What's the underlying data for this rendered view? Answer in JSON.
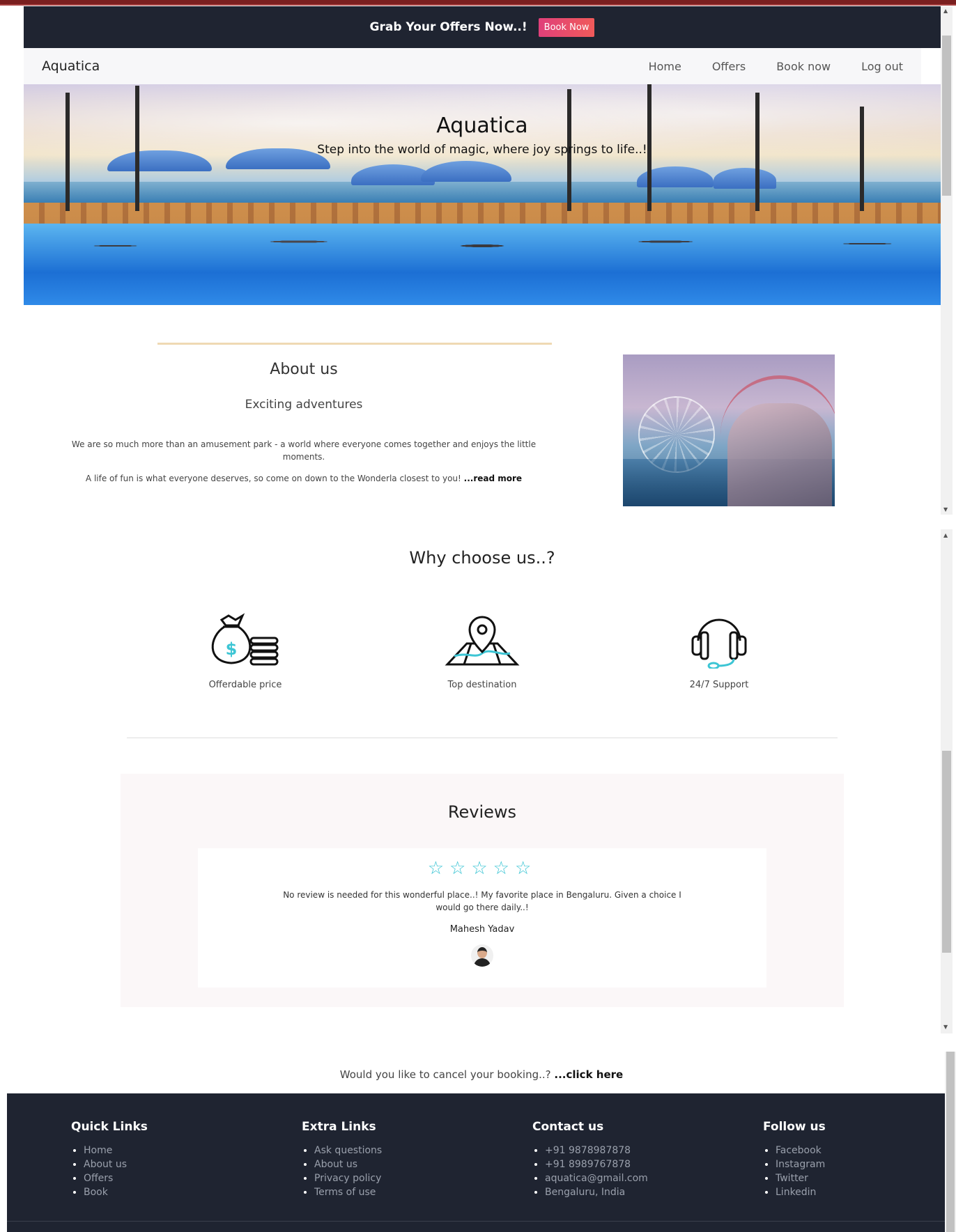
{
  "promo": {
    "text": "Grab Your Offers Now..!",
    "button": "Book Now"
  },
  "navbar": {
    "brand": "Aquatica",
    "links": [
      "Home",
      "Offers",
      "Book now",
      "Log out"
    ]
  },
  "hero": {
    "title": "Aquatica",
    "subtitle": "Step into the world of magic, where joy springs to life..!"
  },
  "about": {
    "title": "About us",
    "subtitle": "Exciting adventures",
    "paragraph1": "We are so much more than an amusement park - a world where everyone comes together and enjoys the little moments.",
    "paragraph2": "A life of fun is what everyone deserves, so come on down to the Wonderla closest to you!",
    "read_more": "...read more"
  },
  "why": {
    "title": "Why choose us..?",
    "features": [
      {
        "icon": "money-bag-icon",
        "label": "Offerdable price"
      },
      {
        "icon": "map-pin-icon",
        "label": "Top destination"
      },
      {
        "icon": "headset-icon",
        "label": "24/7 Support"
      }
    ]
  },
  "reviews": {
    "title": "Reviews",
    "stars": "☆☆☆☆☆",
    "text": "No review is needed for this wonderful place..! My favorite place in Bengaluru. Given a choice I would go there daily..!",
    "reviewer": "Mahesh Yadav"
  },
  "cancel": {
    "text": "Would you like to cancel your booking..?",
    "link": "...click here"
  },
  "footer": {
    "columns": [
      {
        "title": "Quick Links",
        "items": [
          "Home",
          "About us",
          "Offers",
          "Book"
        ]
      },
      {
        "title": "Extra Links",
        "items": [
          "Ask questions",
          "About us",
          "Privacy policy",
          "Terms of use"
        ]
      },
      {
        "title": "Contact us",
        "items": [
          "+91 9878987878",
          "+91 8989767878",
          "aquatica@gmail.com",
          "Bengaluru, India"
        ]
      },
      {
        "title": "Follow us",
        "items": [
          "Facebook",
          "Instagram",
          "Twitter",
          "Linkedin"
        ]
      }
    ]
  },
  "colors": {
    "dark": "#1f2431",
    "accent_star": "#3cc5d4",
    "promo_button": "#e0407a"
  }
}
